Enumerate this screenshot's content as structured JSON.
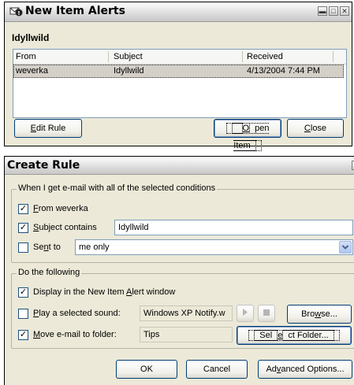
{
  "alerts": {
    "title": "New Item Alerts",
    "rule_name": "Idyllwild",
    "columns": [
      "From",
      "Subject",
      "Received"
    ],
    "rows": [
      {
        "from": "weverka",
        "subject": "Idyllwild",
        "received": "4/13/2004 7:44 PM"
      }
    ],
    "edit_rule": {
      "pre": "",
      "key": "E",
      "post": "dit Rule"
    },
    "open_item": {
      "pre": "",
      "key": "O",
      "post": "pen Item"
    },
    "close": {
      "pre": "",
      "key": "C",
      "post": "lose"
    }
  },
  "create_rule": {
    "title": "Create Rule",
    "conditions_label": "When I get e-mail with all of the selected conditions",
    "from": {
      "checked": true,
      "pre": "",
      "key": "F",
      "post": "rom weverka"
    },
    "subject": {
      "checked": true,
      "pre": "",
      "key": "S",
      "post": "ubject contains",
      "value": "Idyllwild"
    },
    "sent_to": {
      "checked": false,
      "pre": "Se",
      "key": "n",
      "post": "t to",
      "value": "me only"
    },
    "actions_label": "Do the following",
    "display": {
      "checked": true,
      "pre": "Display in the New Item ",
      "key": "A",
      "post": "lert window"
    },
    "sound": {
      "checked": false,
      "pre": "",
      "key": "P",
      "post": "lay a selected sound:",
      "value": "Windows XP Notify.w"
    },
    "browse": {
      "pre": "Bro",
      "key": "w",
      "post": "se..."
    },
    "move": {
      "checked": true,
      "pre": "",
      "key": "M",
      "post": "ove e-mail to folder:",
      "value": "Tips"
    },
    "select_folder": {
      "pre": "Sel",
      "key": "e",
      "post": "ct Folder..."
    },
    "ok": "OK",
    "cancel": "Cancel",
    "advanced": {
      "pre": "Ad",
      "key": "v",
      "post": "anced Options..."
    }
  }
}
